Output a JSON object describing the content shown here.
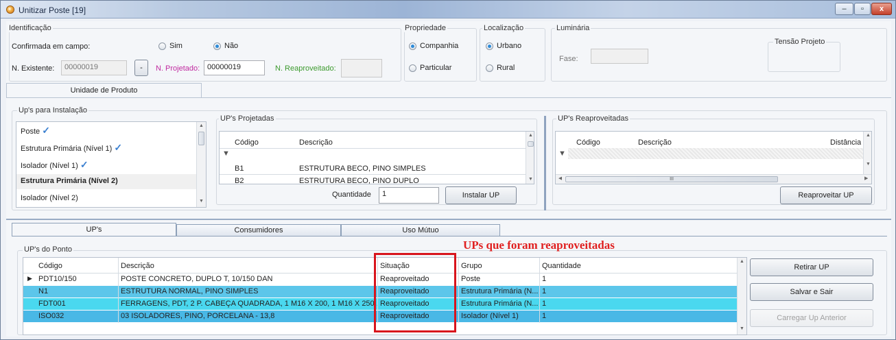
{
  "window": {
    "title": "Unitizar Poste [19]",
    "minimize_label": "–",
    "maximize_label": "▫",
    "close_label": "x"
  },
  "identificacao": {
    "group_label": "Identificação",
    "confirmada_label": "Confirmada em campo:",
    "sim_label": "Sim",
    "nao_label": "Não",
    "confirmada_selected": "Não",
    "existente_label": "N. Existente:",
    "existente_value": "00000019",
    "dash_button": "-",
    "projetado_label": "N. Projetado:",
    "projetado_value": "00000019",
    "reaproveitado_label": "N. Reaproveitado:",
    "reaproveitado_value": ""
  },
  "propriedade": {
    "group_label": "Propriedade",
    "companhia_label": "Companhia",
    "particular_label": "Particular",
    "selected": "Companhia"
  },
  "localizacao": {
    "group_label": "Localização",
    "urbano_label": "Urbano",
    "rural_label": "Rural",
    "selected": "Urbano"
  },
  "luminaria": {
    "group_label": "Luminária",
    "fase_label": "Fase:",
    "fase_value": "",
    "tensao_label": "Tensão Projeto"
  },
  "top_tab": {
    "label": "Unidade de Produto"
  },
  "ups_instalacao": {
    "group_label": "Up's para Instalação",
    "items": [
      {
        "label": "Poste",
        "checked": true,
        "bold": false
      },
      {
        "label": "Estrutura Primária (Nível 1)",
        "checked": true,
        "bold": false
      },
      {
        "label": "Isolador (Nível 1)",
        "checked": true,
        "bold": false
      },
      {
        "label": "Estrutura Primária (Nível 2)",
        "checked": false,
        "bold": true
      },
      {
        "label": "Isolador (Nível 2)",
        "checked": false,
        "bold": false
      }
    ],
    "check_glyph": "✓"
  },
  "ups_projetadas": {
    "group_label": "UP's Projetadas",
    "columns": [
      "Código",
      "Descrição"
    ],
    "rows": [
      {
        "codigo": "B1",
        "descricao": "ESTRUTURA BECO, PINO SIMPLES"
      },
      {
        "codigo": "B2",
        "descricao": "ESTRUTURA BECO, PINO DUPLO"
      }
    ],
    "quantidade_label": "Quantidade",
    "quantidade_value": "1",
    "instalar_button": "Instalar UP"
  },
  "ups_reaproveitadas": {
    "group_label": "UP's Reaproveitadas",
    "columns": [
      "Código",
      "Descrição",
      "Distância"
    ],
    "reaproveitar_button": "Reaproveitar UP",
    "scroll_grip": "III"
  },
  "bottom_tabs": [
    {
      "label": "UP's",
      "active": true
    },
    {
      "label": "Consumidores",
      "active": false
    },
    {
      "label": "Uso Mútuo",
      "active": false
    }
  ],
  "ups_ponto": {
    "group_label": "UP's do Ponto",
    "columns": [
      "Código",
      "Descrição",
      "Situação",
      "Grupo",
      "Quantidade"
    ],
    "row_marker": "▶",
    "rows": [
      {
        "codigo": "PDT10/150",
        "descricao": "POSTE CONCRETO, DUPLO T, 10/150 DAN",
        "situacao": "Reaproveitado",
        "grupo": "Poste",
        "quantidade": "1",
        "color": "white"
      },
      {
        "codigo": "N1",
        "descricao": "ESTRUTURA NORMAL, PINO SIMPLES",
        "situacao": "Reaproveitado",
        "grupo": "Estrutura Primária (N...",
        "quantidade": "1",
        "color": "lblue"
      },
      {
        "codigo": "FDT001",
        "descricao": "FERRAGENS, PDT, 2 P. CABEÇA QUADRADA, 1 M16 X 200, 1 M16 X 250,...",
        "situacao": "Reaproveitado",
        "grupo": "Estrutura Primária (N...",
        "quantidade": "1",
        "color": "cyan"
      },
      {
        "codigo": "ISO032",
        "descricao": "03 ISOLADORES, PINO, PORCELANA - 13,8",
        "situacao": "Reaproveitado",
        "grupo": "Isolador (Nível 1)",
        "quantidade": "1",
        "color": "blue"
      }
    ],
    "retirar_button": "Retirar UP",
    "salvar_button": "Salvar e Sair",
    "carregar_button": "Carregar Up Anterior"
  },
  "annotation": {
    "label": "UPs que foram reaproveitadas",
    "color": "#d8141c"
  },
  "colors": {
    "row_cyan": "#4ad8ef",
    "row_lightblue": "#5cc6ea",
    "row_blue": "#49b8e6",
    "projetado_label": "#c02aa0",
    "reaproveitado_label": "#3b9a2d",
    "radio_selected": "#2c8ad8"
  }
}
